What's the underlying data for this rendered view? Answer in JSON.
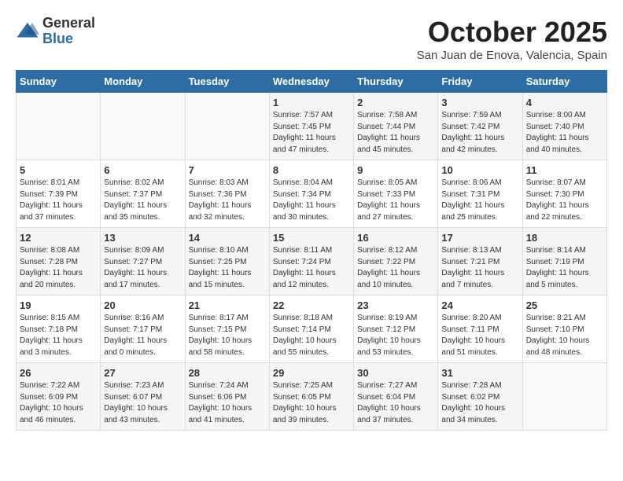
{
  "logo": {
    "general": "General",
    "blue": "Blue"
  },
  "title": "October 2025",
  "subtitle": "San Juan de Enova, Valencia, Spain",
  "days_header": [
    "Sunday",
    "Monday",
    "Tuesday",
    "Wednesday",
    "Thursday",
    "Friday",
    "Saturday"
  ],
  "weeks": [
    [
      {
        "day": "",
        "content": ""
      },
      {
        "day": "",
        "content": ""
      },
      {
        "day": "",
        "content": ""
      },
      {
        "day": "1",
        "content": "Sunrise: 7:57 AM\nSunset: 7:45 PM\nDaylight: 11 hours and 47 minutes."
      },
      {
        "day": "2",
        "content": "Sunrise: 7:58 AM\nSunset: 7:44 PM\nDaylight: 11 hours and 45 minutes."
      },
      {
        "day": "3",
        "content": "Sunrise: 7:59 AM\nSunset: 7:42 PM\nDaylight: 11 hours and 42 minutes."
      },
      {
        "day": "4",
        "content": "Sunrise: 8:00 AM\nSunset: 7:40 PM\nDaylight: 11 hours and 40 minutes."
      }
    ],
    [
      {
        "day": "5",
        "content": "Sunrise: 8:01 AM\nSunset: 7:39 PM\nDaylight: 11 hours and 37 minutes."
      },
      {
        "day": "6",
        "content": "Sunrise: 8:02 AM\nSunset: 7:37 PM\nDaylight: 11 hours and 35 minutes."
      },
      {
        "day": "7",
        "content": "Sunrise: 8:03 AM\nSunset: 7:36 PM\nDaylight: 11 hours and 32 minutes."
      },
      {
        "day": "8",
        "content": "Sunrise: 8:04 AM\nSunset: 7:34 PM\nDaylight: 11 hours and 30 minutes."
      },
      {
        "day": "9",
        "content": "Sunrise: 8:05 AM\nSunset: 7:33 PM\nDaylight: 11 hours and 27 minutes."
      },
      {
        "day": "10",
        "content": "Sunrise: 8:06 AM\nSunset: 7:31 PM\nDaylight: 11 hours and 25 minutes."
      },
      {
        "day": "11",
        "content": "Sunrise: 8:07 AM\nSunset: 7:30 PM\nDaylight: 11 hours and 22 minutes."
      }
    ],
    [
      {
        "day": "12",
        "content": "Sunrise: 8:08 AM\nSunset: 7:28 PM\nDaylight: 11 hours and 20 minutes."
      },
      {
        "day": "13",
        "content": "Sunrise: 8:09 AM\nSunset: 7:27 PM\nDaylight: 11 hours and 17 minutes."
      },
      {
        "day": "14",
        "content": "Sunrise: 8:10 AM\nSunset: 7:25 PM\nDaylight: 11 hours and 15 minutes."
      },
      {
        "day": "15",
        "content": "Sunrise: 8:11 AM\nSunset: 7:24 PM\nDaylight: 11 hours and 12 minutes."
      },
      {
        "day": "16",
        "content": "Sunrise: 8:12 AM\nSunset: 7:22 PM\nDaylight: 11 hours and 10 minutes."
      },
      {
        "day": "17",
        "content": "Sunrise: 8:13 AM\nSunset: 7:21 PM\nDaylight: 11 hours and 7 minutes."
      },
      {
        "day": "18",
        "content": "Sunrise: 8:14 AM\nSunset: 7:19 PM\nDaylight: 11 hours and 5 minutes."
      }
    ],
    [
      {
        "day": "19",
        "content": "Sunrise: 8:15 AM\nSunset: 7:18 PM\nDaylight: 11 hours and 3 minutes."
      },
      {
        "day": "20",
        "content": "Sunrise: 8:16 AM\nSunset: 7:17 PM\nDaylight: 11 hours and 0 minutes."
      },
      {
        "day": "21",
        "content": "Sunrise: 8:17 AM\nSunset: 7:15 PM\nDaylight: 10 hours and 58 minutes."
      },
      {
        "day": "22",
        "content": "Sunrise: 8:18 AM\nSunset: 7:14 PM\nDaylight: 10 hours and 55 minutes."
      },
      {
        "day": "23",
        "content": "Sunrise: 8:19 AM\nSunset: 7:12 PM\nDaylight: 10 hours and 53 minutes."
      },
      {
        "day": "24",
        "content": "Sunrise: 8:20 AM\nSunset: 7:11 PM\nDaylight: 10 hours and 51 minutes."
      },
      {
        "day": "25",
        "content": "Sunrise: 8:21 AM\nSunset: 7:10 PM\nDaylight: 10 hours and 48 minutes."
      }
    ],
    [
      {
        "day": "26",
        "content": "Sunrise: 7:22 AM\nSunset: 6:09 PM\nDaylight: 10 hours and 46 minutes."
      },
      {
        "day": "27",
        "content": "Sunrise: 7:23 AM\nSunset: 6:07 PM\nDaylight: 10 hours and 43 minutes."
      },
      {
        "day": "28",
        "content": "Sunrise: 7:24 AM\nSunset: 6:06 PM\nDaylight: 10 hours and 41 minutes."
      },
      {
        "day": "29",
        "content": "Sunrise: 7:25 AM\nSunset: 6:05 PM\nDaylight: 10 hours and 39 minutes."
      },
      {
        "day": "30",
        "content": "Sunrise: 7:27 AM\nSunset: 6:04 PM\nDaylight: 10 hours and 37 minutes."
      },
      {
        "day": "31",
        "content": "Sunrise: 7:28 AM\nSunset: 6:02 PM\nDaylight: 10 hours and 34 minutes."
      },
      {
        "day": "",
        "content": ""
      }
    ]
  ]
}
